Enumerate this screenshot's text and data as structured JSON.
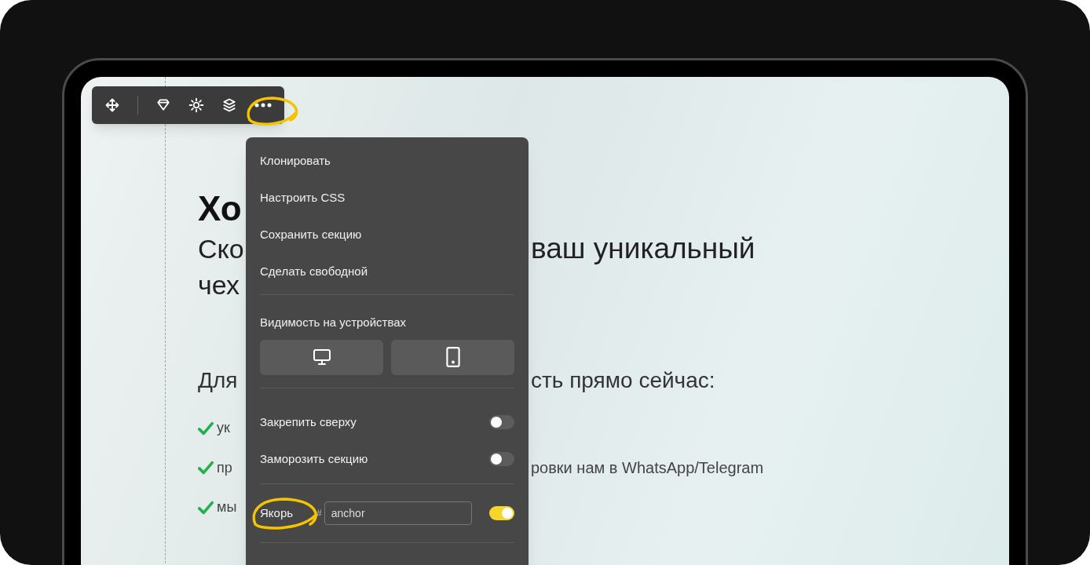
{
  "toolbar": {
    "items": [
      {
        "kind": "move"
      },
      {
        "kind": "divider"
      },
      {
        "kind": "design"
      },
      {
        "kind": "settings"
      },
      {
        "kind": "layers"
      },
      {
        "kind": "more",
        "highlighted": true
      }
    ]
  },
  "page": {
    "heading": "Хо",
    "subheading_lines": [
      {
        "left": "Ско",
        "right": "ваш уникальный"
      },
      {
        "left": "чех"
      }
    ],
    "intro": {
      "left": "Для",
      "right": "сть прямо сейчас:"
    },
    "bullets": [
      {
        "left": "ук"
      },
      {
        "left": "пр",
        "right": "ровки нам в WhatsApp/Telegram"
      },
      {
        "left": "мы"
      }
    ]
  },
  "menu": {
    "actions": [
      "Клонировать",
      "Настроить CSS",
      "Сохранить секцию",
      "Сделать свободной"
    ],
    "visibility": {
      "label": "Видимость на устройствах",
      "devices": [
        {
          "kind": "desktop"
        },
        {
          "kind": "mobile"
        }
      ]
    },
    "toggles": [
      {
        "label": "Закрепить сверху",
        "on": false
      },
      {
        "label": "Заморозить секцию",
        "on": false
      }
    ],
    "anchor": {
      "label": "Якорь",
      "prefix": "#",
      "value": "anchor",
      "on": true,
      "highlighted": true
    }
  }
}
